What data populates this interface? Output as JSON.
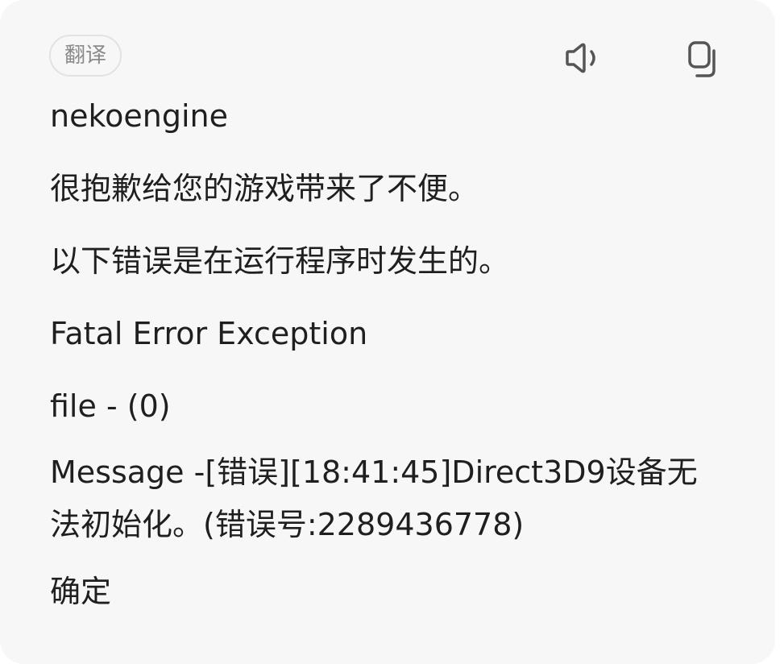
{
  "header": {
    "translate_chip": "翻译",
    "speaker_icon": "speaker-icon",
    "copy_icon": "copy-icon"
  },
  "content": {
    "lines": [
      "nekoengine",
      "很抱歉给您的游戏带来了不便。",
      "以下错误是在运行程序时发生的。",
      "Fatal Error Exception",
      "file - (0)",
      "Message -[错误][18:41:45]Direct3D9设备无法初始化。(错误号:2289436778)",
      "确定"
    ]
  },
  "colors": {
    "card_background": "#f7f7f7",
    "text": "#1f1f1f",
    "chip_text": "#8a8a8a",
    "chip_border": "#e2e2e2",
    "icon": "#555555"
  }
}
